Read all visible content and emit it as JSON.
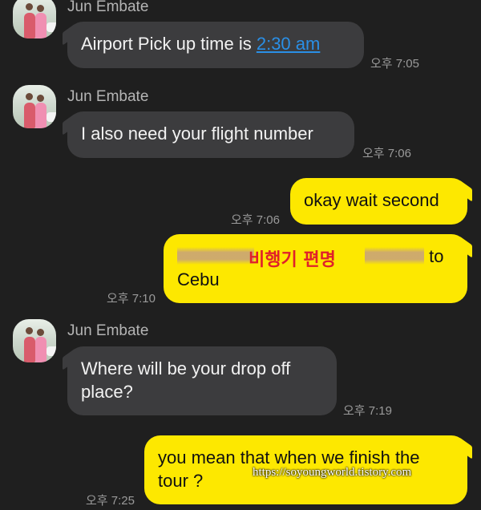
{
  "contact": {
    "name": "Jun Embate"
  },
  "messages": [
    {
      "prefix": "Airport Pick up time is ",
      "link": "2:30 am",
      "time": "오후 7:05"
    },
    {
      "text": "I also need your flight number",
      "time": "오후 7:06"
    },
    {
      "text": "okay wait second",
      "time": "오후 7:06"
    },
    {
      "redacted_label": "비행기 편명",
      "line1_tail": "to",
      "line2": "Cebu",
      "time": "오후 7:10"
    },
    {
      "text": "Where will be your drop off place?",
      "time": "오후 7:19"
    },
    {
      "text": "you mean that when we finish the tour ?",
      "time": "오후 7:25"
    }
  ],
  "watermark": "https://soyoungworld.tistory.com",
  "colors": {
    "background": "#1f1f1f",
    "incoming_bubble": "#3c3c3e",
    "outgoing_bubble": "#fde800",
    "link": "#2a8fe6",
    "redaction_label": "#e0202a"
  }
}
